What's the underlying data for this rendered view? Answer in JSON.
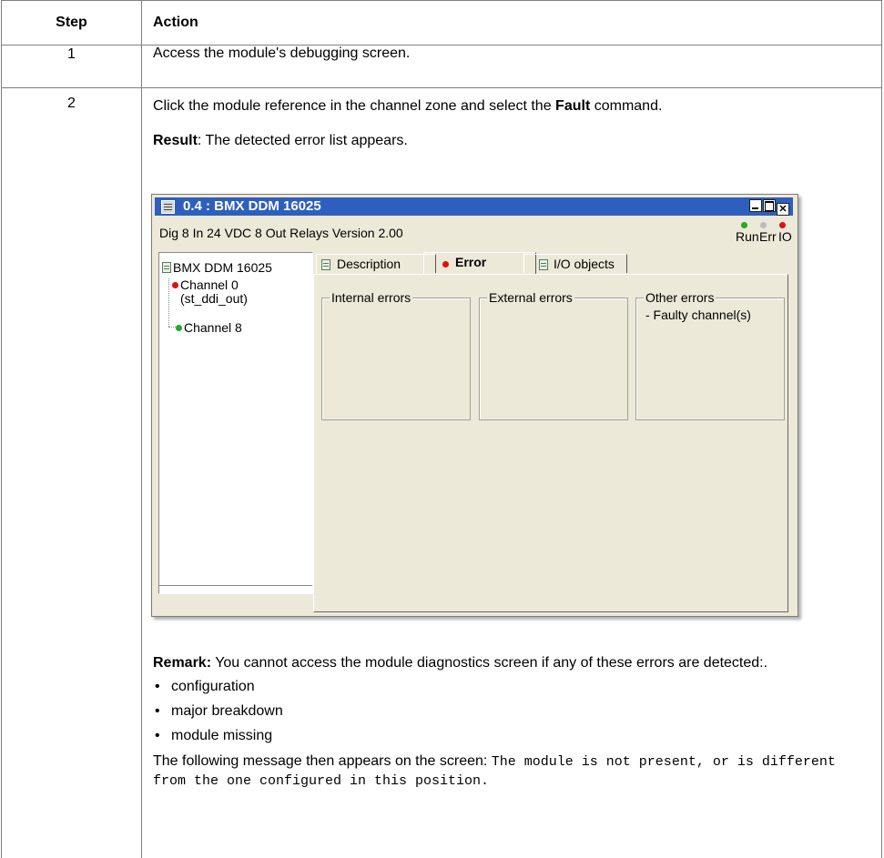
{
  "table": {
    "header": {
      "step": "Step",
      "action": "Action"
    },
    "row1": {
      "step": "1",
      "text": "Access the module's debugging screen."
    },
    "row2": {
      "step": "2",
      "line1_a": "Click the module reference in the channel zone and select the ",
      "line1_bold": "Fault",
      "line1_b": " command.",
      "result_label": "Result",
      "result_text": ": The detected error list appears.",
      "remark_label": "Remark:",
      "remark_text": " You cannot access the module diagnostics screen if any of these errors are detected:.",
      "bullets": [
        "configuration",
        "major breakdown",
        "module missing"
      ],
      "message_intro": "The following message then appears on the screen: ",
      "message_code": "The module is not present, or is different from the one configured in this position."
    }
  },
  "window": {
    "title": "0.4 : BMX DDM 16025",
    "subtitle": "Dig 8 In 24 VDC 8 Out Relays Version 2.00",
    "leds": {
      "run": "Run",
      "err": "Err",
      "io": "IO"
    },
    "led_colors": {
      "run": "#22aa22",
      "err": "#bbbbbb",
      "io": "#dd1111"
    },
    "tree": {
      "module": "BMX DDM 16025",
      "channels": [
        {
          "line1": "Channel 0",
          "line2": "(st_ddi_out)",
          "status_color": "#dd1111"
        },
        {
          "line1": "Channel 8",
          "status_color": "#22aa22"
        }
      ]
    },
    "tabs": [
      "Description",
      "Error",
      "I/O objects"
    ],
    "active_tab": "Error",
    "groups": {
      "internal": "Internal errors",
      "external": "External errors",
      "other": "Other errors",
      "other_content": "- Faulty channel(s)"
    }
  }
}
